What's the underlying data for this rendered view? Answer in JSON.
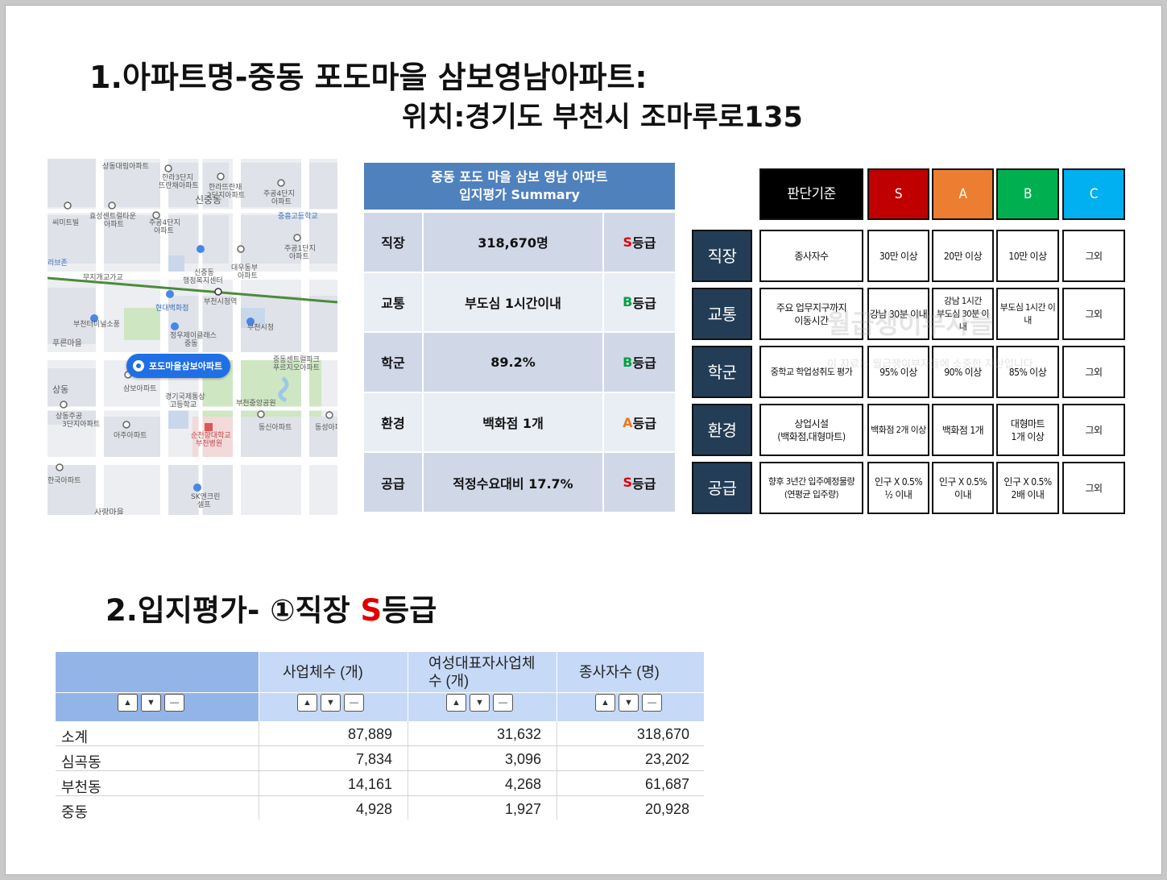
{
  "title": {
    "line1": "1.아파트명-중동 포도마을 삼보영남아파트:",
    "line2": "위치:경기도 부천시 조마루로135"
  },
  "section2": {
    "prefix": "2.입지평가- ①직장  ",
    "grade_letter": "S",
    "grade_suffix": "등급"
  },
  "map": {
    "pin_label": "포도마을삼보아파트",
    "labels": [
      "상동대림아파트",
      "한라3단지",
      "뜨란채아파트",
      "한라뜨란채",
      "2단지아파트",
      "신중동",
      "주공4단지",
      "아파트",
      "중흥고등학교",
      "씨미트빌",
      "효성센트럴타운",
      "아파트",
      "주공4단지",
      "아파트",
      "주공1단지",
      "아파트",
      "리브존",
      "신중동",
      "행정복지센터",
      "대우동부",
      "아파트",
      "무지개교가교",
      "현대백화점",
      "부천시청역",
      "부천터미널소풍",
      "부천시청",
      "푸른마을",
      "정우제이클래스",
      "중동",
      "중동센트럴파크",
      "푸르지오아파트",
      "상동",
      "삼보아파트",
      "경기국제통상",
      "고등학교",
      "부천중앙공원",
      "상동주공",
      "3단지아파트",
      "아주아파트",
      "순천향대학교",
      "부천병원",
      "동신아파트",
      "동성아파",
      "한국아파트",
      "SK엔크린",
      "셀프",
      "사랑마을"
    ]
  },
  "summary": {
    "header_line1": "중동 포도 마을 삼보 영남 아파트",
    "header_line2": "입지평가 Summary",
    "rows": [
      {
        "category": "직장",
        "value": "318,670명",
        "grade": "S",
        "grade_suffix": "등급"
      },
      {
        "category": "교통",
        "value": "부도심 1시간이내",
        "grade": "B",
        "grade_suffix": "등급"
      },
      {
        "category": "학군",
        "value": "89.2%",
        "grade": "B",
        "grade_suffix": "등급"
      },
      {
        "category": "환경",
        "value": "백화점 1개",
        "grade": "A",
        "grade_suffix": "등급"
      },
      {
        "category": "공급",
        "value": "적정수요대비 17.7%",
        "grade": "S",
        "grade_suffix": "등급"
      }
    ],
    "colors": {
      "header": "#4f81bd",
      "row_dark": "#d0d8e8",
      "row_light": "#e9edf4",
      "S": "#e00000",
      "A": "#e87a20",
      "B": "#00a040"
    }
  },
  "criteria": {
    "header": {
      "label": "판단기준",
      "S": "S",
      "A": "A",
      "B": "B",
      "C": "C"
    },
    "header_colors": {
      "label": "#000000",
      "S": "#c00000",
      "A": "#ed7d31",
      "B": "#00b050",
      "C": "#00b0f0"
    },
    "rows": [
      {
        "name": "직장",
        "basis": "종사자수",
        "S": "30만 이상",
        "A": "20만 이상",
        "B": "10만 이상",
        "C": "그외"
      },
      {
        "name": "교통",
        "basis": "주요 업무지구까지\n이동시간",
        "S": "강남 30분 이내",
        "A": "강남 1시간\n부도심 30분 이내",
        "B": "부도심 1시간 이내",
        "C": "그외"
      },
      {
        "name": "학군",
        "basis": "중학교 학업성취도 평가",
        "S": "95% 이상",
        "A": "90% 이상",
        "B": "85% 이상",
        "C": "그외"
      },
      {
        "name": "환경",
        "basis": "상업시설\n(백화점,대형마트)",
        "S": "백화점 2개 이상",
        "A": "백화점 1개",
        "B": "대형마트\n1개 이상",
        "C": "그외"
      },
      {
        "name": "공급",
        "basis": "향후 3년간 입주예정물량\n(연평균 입주량)",
        "S": "인구 X 0.5%\n½ 이내",
        "A": "인구 X 0.5%\n이내",
        "B": "인구 X 0.5%\n2배 이내",
        "C": "그외"
      }
    ],
    "watermark": "월급쟁이부자들",
    "watermark_sub": "이 자료는 월급쟁이부자들에 소중한 자산입니다"
  },
  "stats": {
    "columns": [
      "사업체수 (개)",
      "여성대표자사업체\n수 (개)",
      "종사자수 (명)"
    ],
    "rows": [
      {
        "name": "소계",
        "values": [
          "87,889",
          "31,632",
          "318,670"
        ]
      },
      {
        "name": "심곡동",
        "values": [
          "7,834",
          "3,096",
          "23,202"
        ]
      },
      {
        "name": "부천동",
        "values": [
          "14,161",
          "4,268",
          "61,687"
        ]
      },
      {
        "name": "중동",
        "values": [
          "4,928",
          "1,927",
          "20,928"
        ]
      }
    ]
  }
}
